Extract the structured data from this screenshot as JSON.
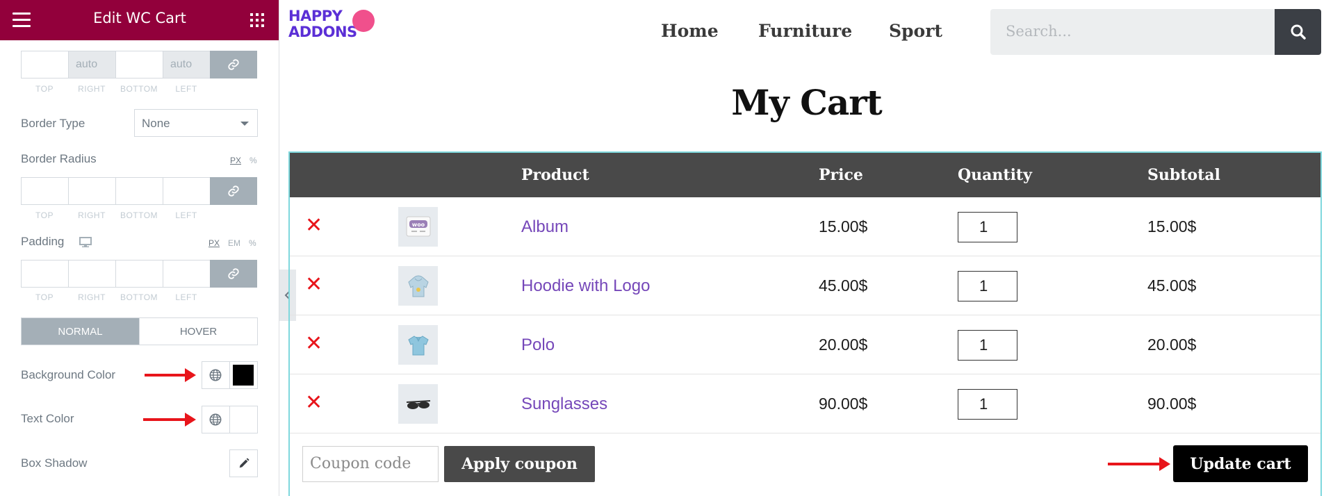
{
  "panel": {
    "title": "Edit WC Cart",
    "margin_row": {
      "values": [
        "",
        "auto",
        "",
        "auto"
      ]
    },
    "dim_labels": [
      "TOP",
      "RIGHT",
      "BOTTOM",
      "LEFT"
    ],
    "border_type": {
      "label": "Border Type",
      "value": "None"
    },
    "border_radius": {
      "label": "Border Radius",
      "units": [
        "PX",
        "%"
      ],
      "active_unit": "PX"
    },
    "padding": {
      "label": "Padding",
      "units": [
        "PX",
        "EM",
        "%"
      ],
      "active_unit": "PX"
    },
    "state_tabs": {
      "normal": "NORMAL",
      "hover": "HOVER",
      "active": "NORMAL"
    },
    "background_color": {
      "label": "Background Color",
      "value": "#000000"
    },
    "text_color": {
      "label": "Text Color",
      "value": "#ffffff"
    },
    "box_shadow": {
      "label": "Box Shadow"
    },
    "icons": [
      "hamburger-icon",
      "apps-grid-icon",
      "link-icon",
      "desktop-icon",
      "globe-icon",
      "pencil-icon",
      "chevron-left-icon"
    ]
  },
  "site": {
    "logo": {
      "line1": "HAPPY",
      "line2": "ADDONS"
    },
    "nav": [
      "Home",
      "Furniture",
      "Sport"
    ],
    "search": {
      "placeholder": "Search..."
    },
    "page_title": "My Cart",
    "cart": {
      "columns": [
        "Product",
        "Price",
        "Quantity",
        "Subtotal"
      ],
      "rows": [
        {
          "product": "Album",
          "price": "15.00$",
          "quantity": "1",
          "subtotal": "15.00$",
          "thumb": "album-thumbnail"
        },
        {
          "product": "Hoodie with Logo",
          "price": "45.00$",
          "quantity": "1",
          "subtotal": "45.00$",
          "thumb": "hoodie-thumbnail"
        },
        {
          "product": "Polo",
          "price": "20.00$",
          "quantity": "1",
          "subtotal": "20.00$",
          "thumb": "polo-thumbnail"
        },
        {
          "product": "Sunglasses",
          "price": "90.00$",
          "quantity": "1",
          "subtotal": "90.00$",
          "thumb": "sunglasses-thumbnail"
        }
      ],
      "coupon_placeholder": "Coupon code",
      "apply_label": "Apply coupon",
      "update_label": "Update cart"
    }
  },
  "colors": {
    "panel_header": "#92003b",
    "table_header": "#494949",
    "product_link": "#7547b9",
    "remove": "#e8151b",
    "cart_border": "#7fd8dd"
  }
}
